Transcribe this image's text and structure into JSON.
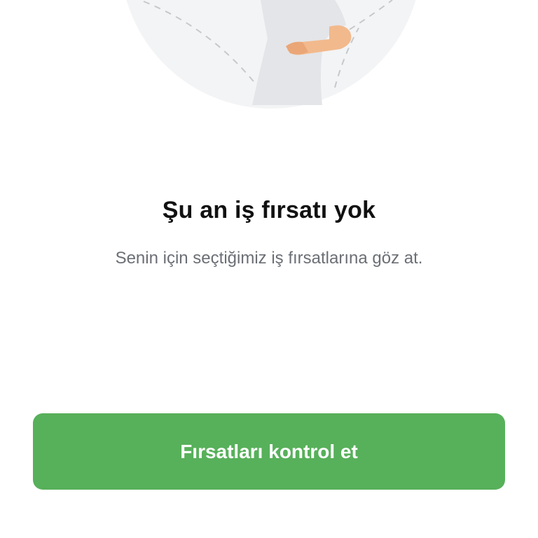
{
  "empty_state": {
    "title": "Şu an iş fırsatı yok",
    "subtitle": "Senin için seçtiğimiz iş fırsatlarına göz at.",
    "illustration_icon": "person-illustration"
  },
  "cta": {
    "label": "Fırsatları kontrol et",
    "color": "#57b05a"
  }
}
